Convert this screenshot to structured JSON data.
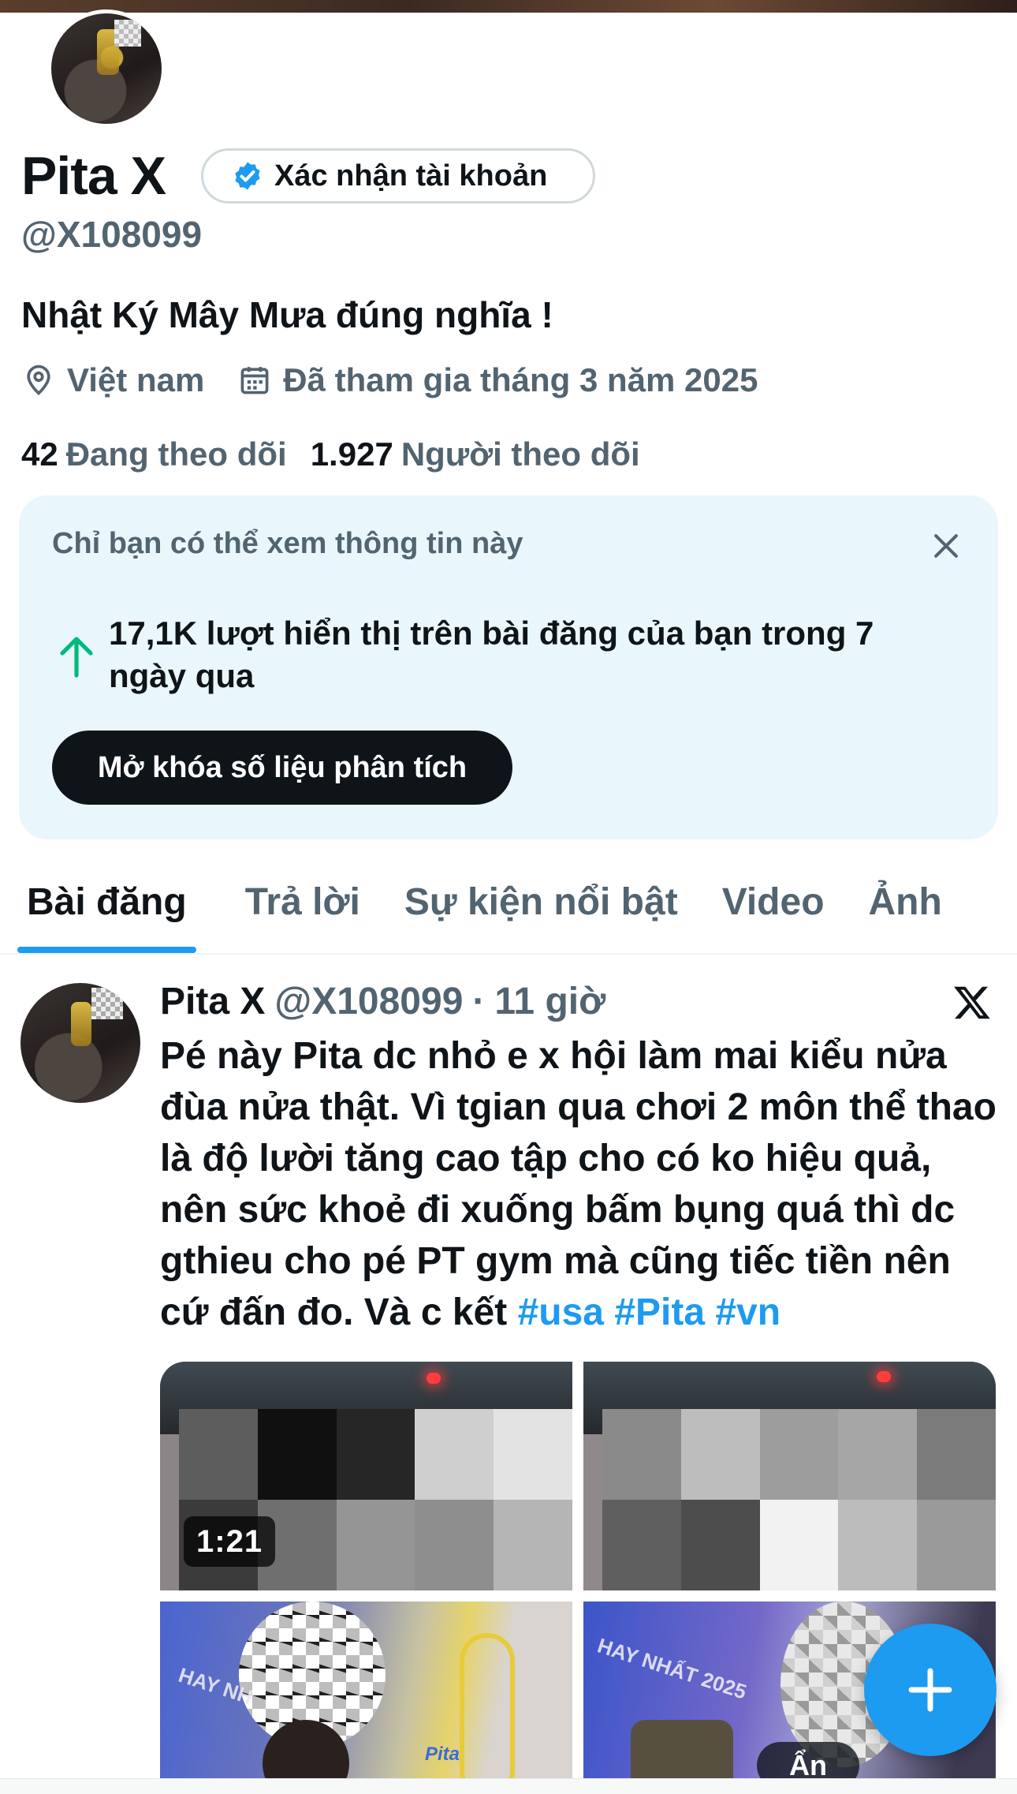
{
  "profile": {
    "display_name": "Pita X",
    "verify_button_label": "Xác nhận tài khoản",
    "handle": "@X108099",
    "bio": "Nhật Ký Mây Mưa đúng nghĩa !",
    "location": "Việt nam",
    "joined": "Đã tham gia tháng 3 năm 2025",
    "following_count": "42",
    "following_label": "Đang theo dõi",
    "followers_count": "1.927",
    "followers_label": "Người theo dõi"
  },
  "insight": {
    "note": "Chỉ bạn có thể xem thông tin này",
    "stat": "17,1K lượt hiển thị trên bài đăng của bạn trong 7 ngày qua",
    "button_label": "Mở khóa số liệu phân tích"
  },
  "tabs": [
    {
      "label": "Bài đăng",
      "active": true
    },
    {
      "label": "Trả lời",
      "active": false
    },
    {
      "label": "Sự kiện nổi bật",
      "active": false
    },
    {
      "label": "Video",
      "active": false
    },
    {
      "label": "Ảnh",
      "active": false
    }
  ],
  "post": {
    "author": "Pita X",
    "handle": "@X108099",
    "separator": "·",
    "time": "11 giờ",
    "text": "Pé này Pita dc nhỏ e x hội làm mai kiểu nửa đùa nửa thật. Vì tgian qua chơi 2 môn thể thao là độ lười tăng cao tập cho có ko hiệu quả, nên sức khoẻ đi xuống bấm bụng quá thì dc gthieu cho pé PT gym mà cũng tiếc tiền nên cứ đấn đo. Và c kết",
    "hashtags": [
      "#usa",
      "#Pita",
      "#vn"
    ],
    "media": {
      "video_duration": "1:21",
      "hidden_label": "Ẩn"
    }
  },
  "colors": {
    "accent": "#1d9bf0",
    "text_primary": "#0f1419",
    "text_secondary": "#536471",
    "insight_bg": "#e9f7fd",
    "trend_up": "#00ba7c"
  },
  "icons": {
    "verified": "verified-badge-icon",
    "location": "location-pin-icon",
    "calendar": "calendar-icon",
    "close": "close-icon",
    "trend": "arrow-up-icon",
    "brand": "x-logo-icon",
    "compose": "plus-icon"
  }
}
